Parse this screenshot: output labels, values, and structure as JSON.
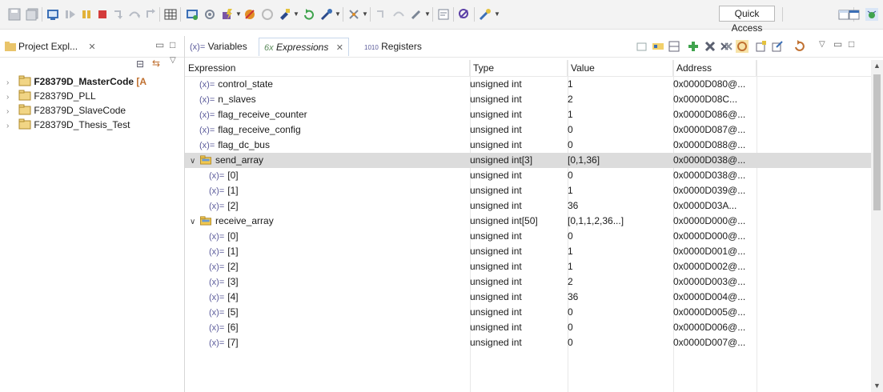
{
  "toolbar": {
    "quick_access_label": "Quick Access",
    "icons": [
      "save-icon",
      "save-all-icon",
      "terminal-icon",
      "resume-icon",
      "suspend-icon",
      "terminate-icon",
      "step-into-icon",
      "step-over-icon",
      "step-return-icon",
      "memory-browser-icon",
      "debug-icon",
      "gear-icon",
      "flash-icon",
      "breakpoint-icon",
      "run-icon",
      "perspective-icon",
      "java-perspective-icon"
    ]
  },
  "project_explorer": {
    "tab_label": "Project Expl...",
    "projects": [
      {
        "name": "F28379D_MasterCode",
        "suffix": "[A",
        "active": true
      },
      {
        "name": "F28379D_PLL",
        "suffix": "",
        "active": false
      },
      {
        "name": "F28379D_SlaveCode",
        "suffix": "",
        "active": false
      },
      {
        "name": "F28379D_Thesis_Test",
        "suffix": "",
        "active": false
      }
    ]
  },
  "views": {
    "tabs": [
      {
        "label": "Variables",
        "prefix": "(x)="
      },
      {
        "label": "Expressions",
        "prefix": "6x"
      },
      {
        "label": "Registers",
        "prefix": "1010"
      }
    ]
  },
  "table": {
    "headers": [
      "Expression",
      "Type",
      "Value",
      "Address"
    ],
    "rows": [
      {
        "level": 0,
        "kind": "var",
        "expr": "control_state",
        "type": "unsigned int",
        "value": "1",
        "addr": "0x0000D080@..."
      },
      {
        "level": 0,
        "kind": "var",
        "expr": "n_slaves",
        "type": "unsigned int",
        "value": "2",
        "addr": "0x0000D08C..."
      },
      {
        "level": 0,
        "kind": "var",
        "expr": "flag_receive_counter",
        "type": "unsigned int",
        "value": "1",
        "addr": "0x0000D086@..."
      },
      {
        "level": 0,
        "kind": "var",
        "expr": "flag_receive_config",
        "type": "unsigned int",
        "value": "0",
        "addr": "0x0000D087@..."
      },
      {
        "level": 0,
        "kind": "var",
        "expr": "flag_dc_bus",
        "type": "unsigned int",
        "value": "0",
        "addr": "0x0000D088@..."
      },
      {
        "level": 0,
        "kind": "array",
        "expr": "send_array",
        "type": "unsigned int[3]",
        "value": "[0,1,36]",
        "addr": "0x0000D038@...",
        "selected": true
      },
      {
        "level": 1,
        "kind": "var",
        "expr": "[0]",
        "type": "unsigned int",
        "value": "0",
        "addr": "0x0000D038@..."
      },
      {
        "level": 1,
        "kind": "var",
        "expr": "[1]",
        "type": "unsigned int",
        "value": "1",
        "addr": "0x0000D039@..."
      },
      {
        "level": 1,
        "kind": "var",
        "expr": "[2]",
        "type": "unsigned int",
        "value": "36",
        "addr": "0x0000D03A..."
      },
      {
        "level": 0,
        "kind": "array",
        "expr": "receive_array",
        "type": "unsigned int[50]",
        "value": "[0,1,1,2,36...]",
        "addr": "0x0000D000@..."
      },
      {
        "level": 1,
        "kind": "var",
        "expr": "[0]",
        "type": "unsigned int",
        "value": "0",
        "addr": "0x0000D000@..."
      },
      {
        "level": 1,
        "kind": "var",
        "expr": "[1]",
        "type": "unsigned int",
        "value": "1",
        "addr": "0x0000D001@..."
      },
      {
        "level": 1,
        "kind": "var",
        "expr": "[2]",
        "type": "unsigned int",
        "value": "1",
        "addr": "0x0000D002@..."
      },
      {
        "level": 1,
        "kind": "var",
        "expr": "[3]",
        "type": "unsigned int",
        "value": "2",
        "addr": "0x0000D003@..."
      },
      {
        "level": 1,
        "kind": "var",
        "expr": "[4]",
        "type": "unsigned int",
        "value": "36",
        "addr": "0x0000D004@..."
      },
      {
        "level": 1,
        "kind": "var",
        "expr": "[5]",
        "type": "unsigned int",
        "value": "0",
        "addr": "0x0000D005@..."
      },
      {
        "level": 1,
        "kind": "var",
        "expr": "[6]",
        "type": "unsigned int",
        "value": "0",
        "addr": "0x0000D006@..."
      },
      {
        "level": 1,
        "kind": "var",
        "expr": "[7]",
        "type": "unsigned int",
        "value": "0",
        "addr": "0x0000D007@..."
      }
    ]
  }
}
